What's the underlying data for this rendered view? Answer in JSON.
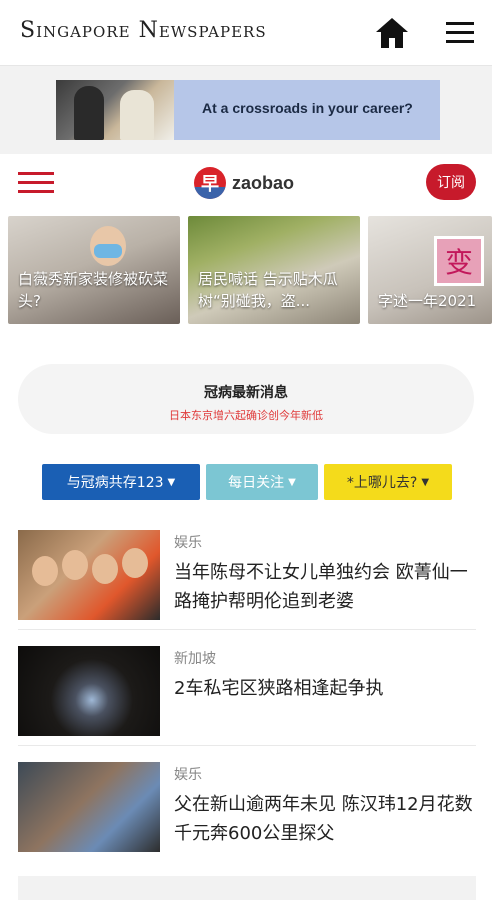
{
  "appbar": {
    "title": "Singapore Newspapers",
    "home_icon": "home-icon",
    "menu_icon": "hamburger-menu-icon"
  },
  "ad": {
    "text": "At a crossroads in your career?"
  },
  "zaobao": {
    "logo_char": "早",
    "logo_word": "zaobao",
    "subscribe_label": "订阅",
    "menu_color": "#c71a2b"
  },
  "carousel": [
    {
      "caption": "白薇秀新家装修被砍菜头?"
    },
    {
      "caption": "居民喊话 告示贴木瓜树“别碰我，盗..."
    },
    {
      "caption": "字述一年2021",
      "sign": "变"
    }
  ],
  "covid": {
    "title": "冠病最新消息",
    "subtitle": "日本东京增六起确诊创今年新低"
  },
  "filters": [
    {
      "label": "与冠病共存123",
      "color": "#1a5fb4"
    },
    {
      "label": "每日关注",
      "color": "#7cc6d3"
    },
    {
      "label": "*上哪儿去?",
      "color": "#f4db1b"
    }
  ],
  "news": [
    {
      "category": "娱乐",
      "headline": "当年陈母不让女儿单独约会 欧菁仙一路掩护帮明伦追到老婆"
    },
    {
      "category": "新加坡",
      "headline": "2车私宅区狭路相逢起争执"
    },
    {
      "category": "娱乐",
      "headline": "父在新山逾两年未见 陈汉玮12月花数千元奔600公里探父"
    }
  ]
}
